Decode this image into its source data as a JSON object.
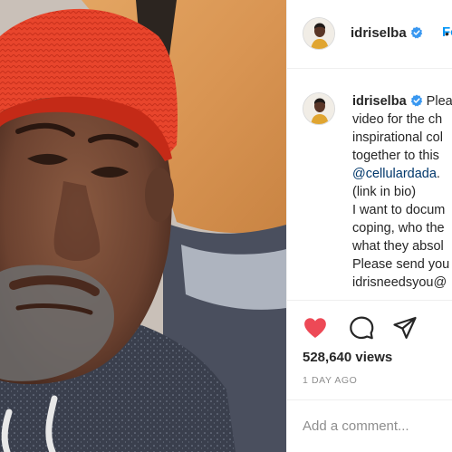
{
  "post": {
    "username": "idriselba",
    "separator": "•",
    "follow_label": "Fo",
    "caption_lines": [
      "Plea",
      "video for the ch",
      "inspirational col",
      "together to this"
    ],
    "mention": "@cellulardada",
    "mention_suffix": ".",
    "caption_lines_2": [
      "(link in bio)",
      "I want to docum",
      "coping, who the",
      "what they absol",
      "Please send you",
      "idrisneedsyou@"
    ],
    "views": "528,640 views",
    "date": "1 DAY AGO",
    "comment_placeholder": "Add a comment..."
  },
  "icons": {
    "verified": "verified-badge-icon",
    "like": "heart-icon",
    "comment": "comment-bubble-icon",
    "share": "paper-plane-icon"
  },
  "colors": {
    "like_red": "#ed4956",
    "verified_blue": "#3897f0",
    "follow_blue": "#0095f6",
    "mention_blue": "#00376b",
    "muted": "#8e8e8e",
    "border": "#efefef",
    "text": "#262626"
  }
}
